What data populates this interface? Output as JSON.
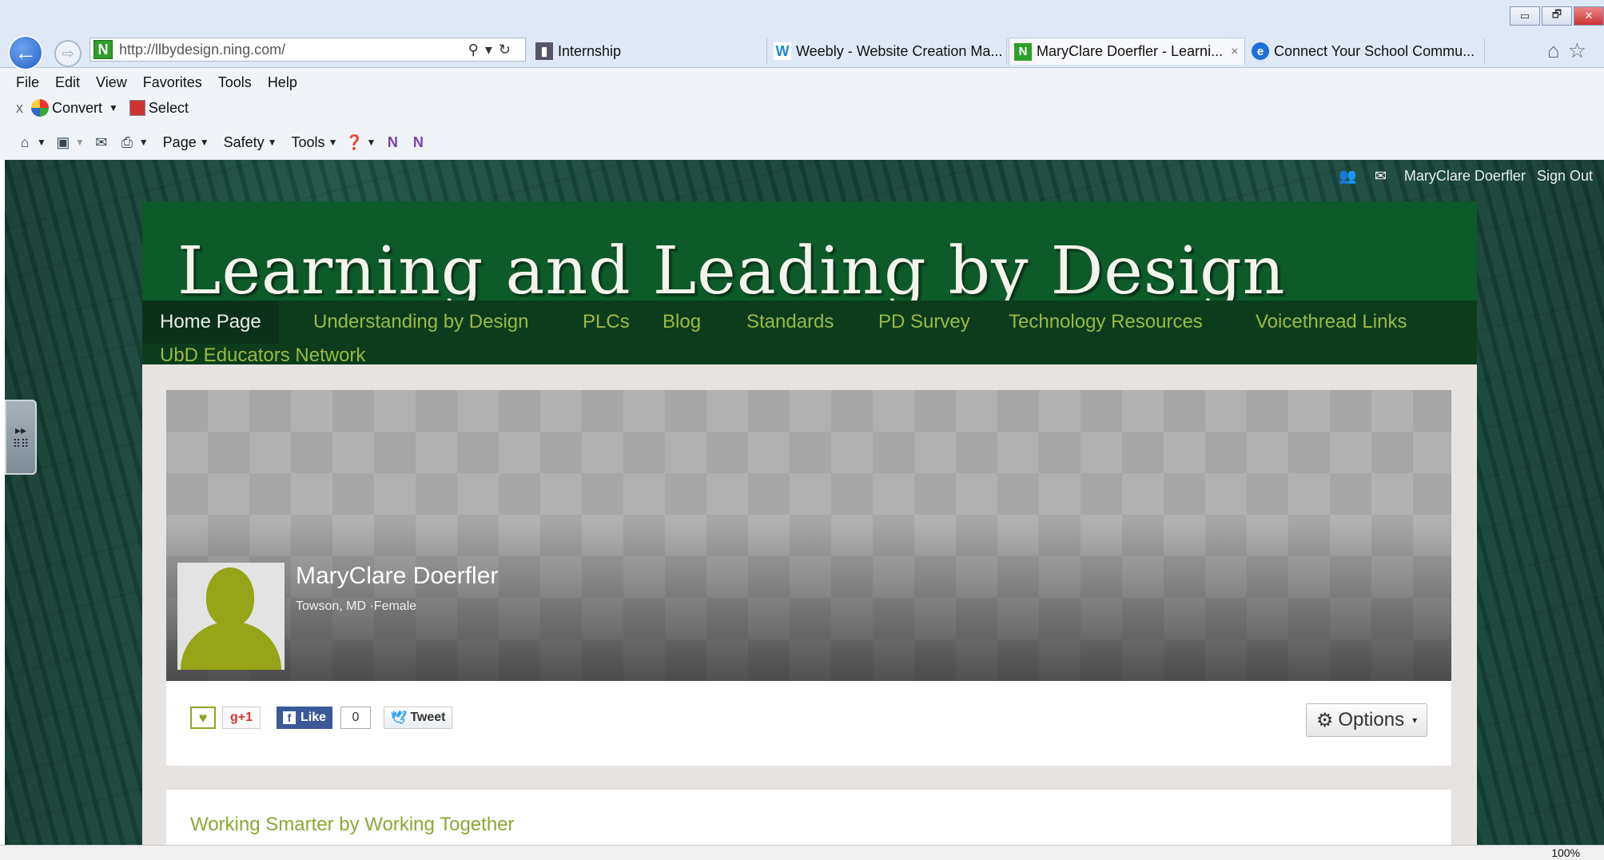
{
  "browser": {
    "address": "http://llbydesign.ning.com/",
    "tabs": [
      {
        "label": "Internship",
        "active": false
      },
      {
        "label": "Weebly - Website Creation Ma...",
        "active": false
      },
      {
        "label": "MaryClare Doerfler - Learni...",
        "active": true
      },
      {
        "label": "Connect Your School Commu...",
        "active": false
      }
    ],
    "tab_close_glyph": "×",
    "window_buttons": {
      "minimize": "▭",
      "restore": "🗗",
      "close": "✕"
    },
    "menu": [
      "File",
      "Edit",
      "View",
      "Favorites",
      "Tools",
      "Help"
    ],
    "toolbar1": {
      "close": "x",
      "convert": "Convert",
      "select": "Select"
    },
    "toolbar2": {
      "page": "Page",
      "safety": "Safety",
      "tools": "Tools"
    },
    "zoom": "100%"
  },
  "page": {
    "user": {
      "name": "MaryClare Doerfler",
      "signout": "Sign Out"
    },
    "site_title": "Learning and Leading by Design",
    "nav": [
      {
        "label": "Home Page",
        "active": true
      },
      {
        "label": "Understanding by Design"
      },
      {
        "label": "PLCs"
      },
      {
        "label": "Blog"
      },
      {
        "label": "Standards"
      },
      {
        "label": "PD Survey"
      },
      {
        "label": "Technology Resources"
      },
      {
        "label": "Voicethread Links"
      },
      {
        "label": "UbD Educators Network"
      }
    ],
    "profile": {
      "name": "MaryClare Doerfler",
      "meta": "Towson, MD  ·Female"
    },
    "share": {
      "gplus": "+1",
      "fb_like": "Like",
      "fb_count": "0",
      "tweet": "Tweet",
      "options": "Options"
    },
    "section_title": "Working Smarter by Working Together"
  },
  "colors": {
    "header_green": "#0d5a2a",
    "nav_green": "#0b3d1d",
    "nav_text": "#9bb944",
    "accent_olive": "#8aa834",
    "avatar_silhouette": "#96a418"
  },
  "icons": [
    "back-icon",
    "forward-icon",
    "search-icon",
    "refresh-icon",
    "home-icon",
    "star-icon",
    "gear-icon",
    "heart-icon",
    "envelope-icon",
    "users-icon",
    "print-icon",
    "help-icon",
    "rss-icon",
    "mail-icon",
    "onenote-icon"
  ]
}
